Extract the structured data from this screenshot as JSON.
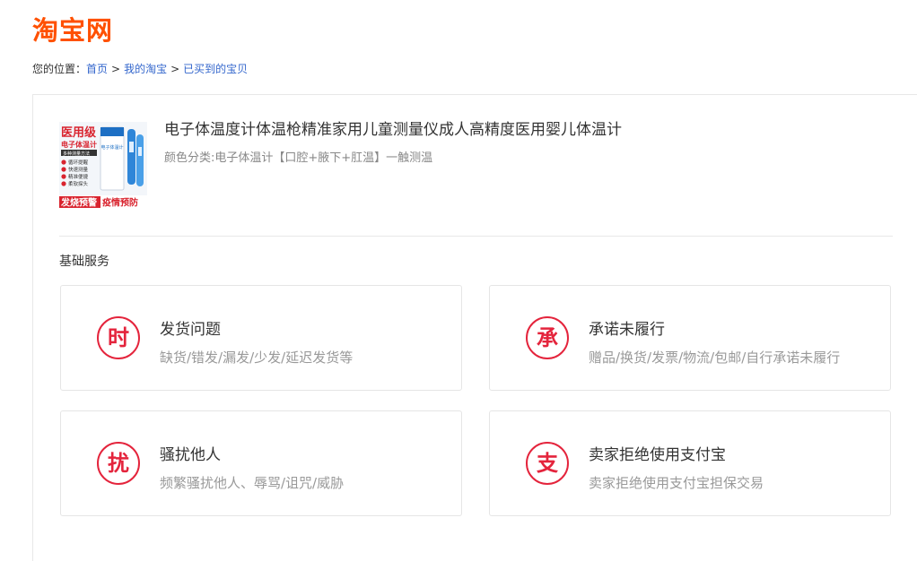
{
  "header": {
    "logo_text": "淘宝网"
  },
  "breadcrumb": {
    "prefix": "您的位置：",
    "items": [
      "首页",
      "我的淘宝",
      "已买到的宝贝"
    ],
    "separator": ">"
  },
  "product": {
    "title": "电子体温度计体温枪精准家用儿童测量仪成人高精度医用婴儿体温计",
    "spec": "颜色分类:电子体温计【口腔+腋下+肛温】一触测温",
    "image": {
      "headline": "医用级",
      "subhead": "电子体温计",
      "tagline": "多种测量方法",
      "features": [
        "循环提醒",
        "快速测量",
        "精准便捷",
        "柔软探头"
      ],
      "device_label": "电子体温计",
      "banner_left": "发烧预警",
      "banner_right": "疫情预防"
    }
  },
  "section": {
    "title": "基础服务"
  },
  "services": [
    {
      "badge": "时",
      "title": "发货问题",
      "desc": "缺货/错发/漏发/少发/延迟发货等"
    },
    {
      "badge": "承",
      "title": "承诺未履行",
      "desc": "赠品/换货/发票/物流/包邮/自行承诺未履行"
    },
    {
      "badge": "扰",
      "title": "骚扰他人",
      "desc": "频繁骚扰他人、辱骂/诅咒/威胁"
    },
    {
      "badge": "支",
      "title": "卖家拒绝使用支付宝",
      "desc": "卖家拒绝使用支付宝担保交易"
    }
  ],
  "colors": {
    "brand": "#ff5000",
    "badge": "#e4243c",
    "link": "#3366cc"
  }
}
